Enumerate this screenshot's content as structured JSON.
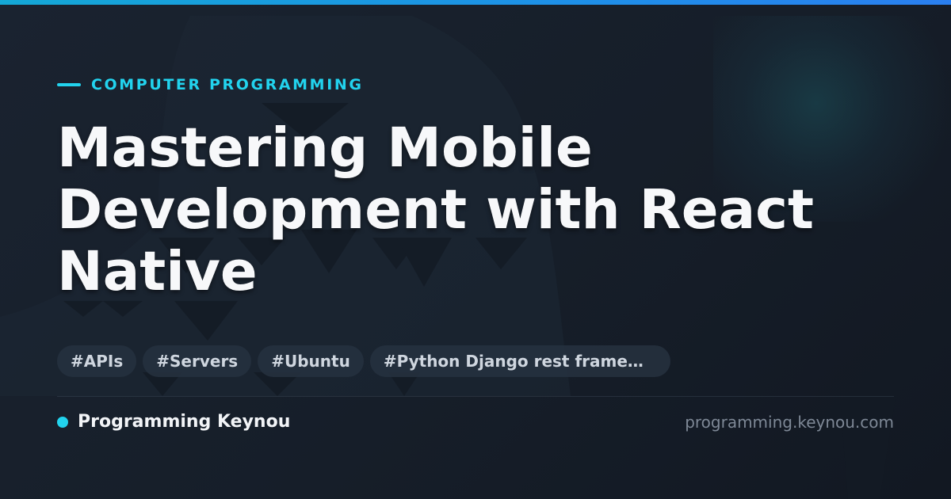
{
  "card": {
    "category": "COMPUTER PROGRAMMING",
    "title": "Mastering Mobile Development with React Native",
    "tags": [
      "#APIs",
      "#Servers",
      "#Ubuntu",
      "#Python Django rest framework"
    ],
    "site_name": "Programming Keynou",
    "site_url": "programming.keynou.com"
  },
  "colors": {
    "accent": "#22d3ee",
    "top_bar": "#1e90e8",
    "background": "#161e29",
    "title": "#f7f8fa",
    "tag_background": "#263140",
    "tag_text": "#cfd6df",
    "url_text": "#7e8896"
  }
}
